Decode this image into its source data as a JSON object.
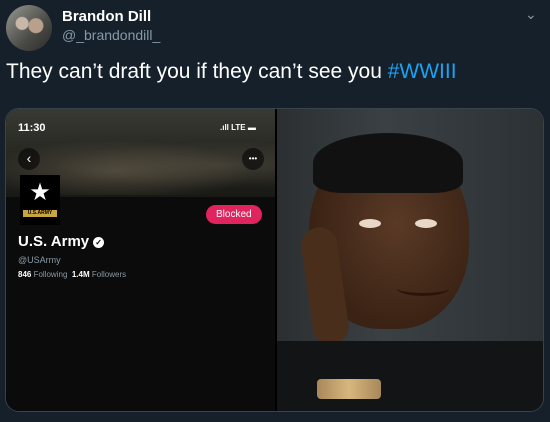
{
  "tweet": {
    "author_name": "Brandon Dill",
    "author_handle": "@_brandondill_",
    "text": "They can’t draft you if they can’t see you ",
    "hashtag": "#WWIII"
  },
  "profile_screenshot": {
    "status_time": "11:30",
    "signal": "LTE",
    "logo_text": "U.S.ARMY",
    "blocked_label": "Blocked",
    "name": "U.S. Army",
    "handle": "@USArmy",
    "following_count": "846",
    "following_label": "Following",
    "followers_count": "1.4M",
    "followers_label": "Followers"
  },
  "colors": {
    "background": "#15202b",
    "hashtag": "#1da1f2",
    "blocked": "#e0245e"
  }
}
